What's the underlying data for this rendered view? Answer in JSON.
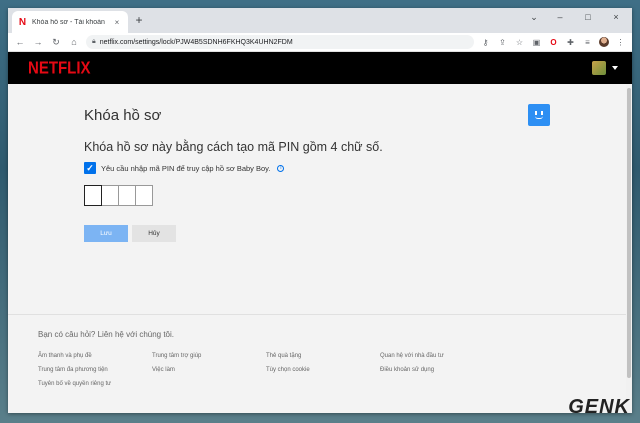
{
  "browser": {
    "tab_title": "Khóa hồ sơ - Tài khoản - Netflix",
    "tab_close": "×",
    "new_tab": "+",
    "url": "netflix.com/settings/lock/PJW4B5SDNH6FKHQ3K4UHN2FDM",
    "window_controls": [
      "⌄",
      "–",
      "□",
      "×"
    ]
  },
  "netflix": {
    "logo": "NETFLIX"
  },
  "main": {
    "title": "Khóa hồ sơ",
    "subtitle": "Khóa hồ sơ này bằng cách tạo mã PIN gồm 4 chữ số.",
    "checkbox_label": "Yêu cầu nhập mã PIN để truy cập hồ sơ Baby Boy.",
    "save_label": "Lưu",
    "cancel_label": "Hủy"
  },
  "footer": {
    "question": "Bạn có câu hỏi? Liên hệ với chúng tôi.",
    "links": [
      "Âm thanh và phụ đề",
      "Trung tâm trợ giúp",
      "Thẻ quà tặng",
      "Quan hệ với nhà đầu tư",
      "Trung tâm đa phương tiện",
      "Việc làm",
      "Tùy chọn cookie",
      "Điều khoản sử dụng",
      "Tuyên bố về quyền riêng tư"
    ]
  },
  "watermark": "GENK",
  "colors": {
    "netflix_red": "#e50914",
    "accent_blue": "#0071eb"
  }
}
